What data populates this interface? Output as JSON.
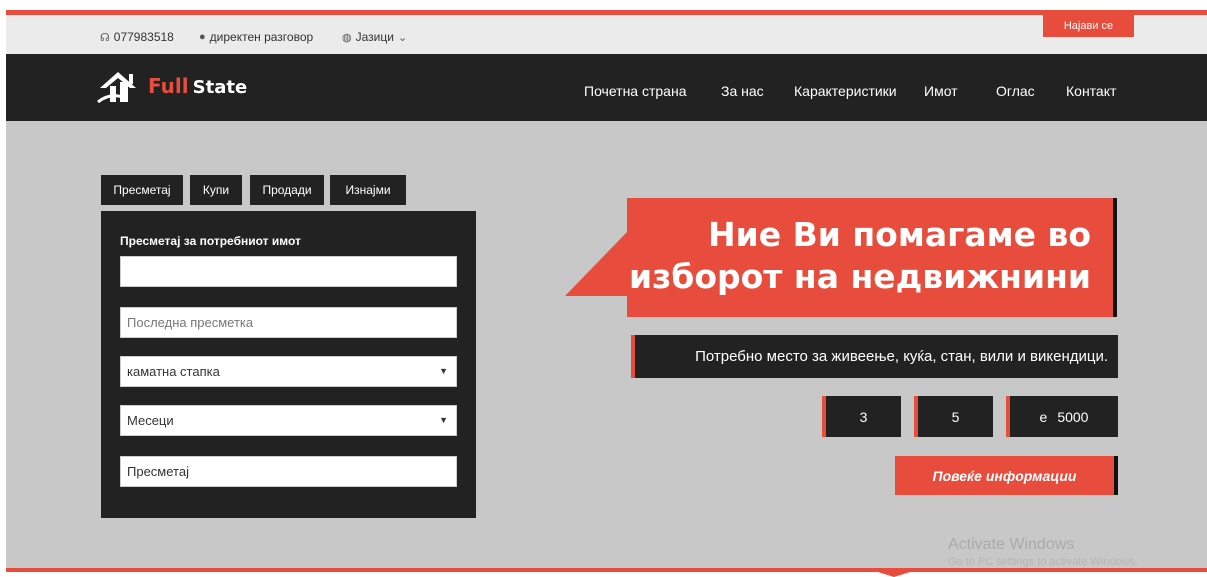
{
  "topbar": {
    "phone": "077983518",
    "chat": "директен разговор",
    "languages": "Јазици",
    "login": "Најави се"
  },
  "brand": {
    "name_part1": "Full",
    "name_part2": "State"
  },
  "nav": {
    "items": [
      "Почетна страна",
      "За нас",
      "Карактеристики",
      "Имот",
      "Оглас",
      "Контакт"
    ]
  },
  "tabs": [
    "Пресметај",
    "Купи",
    "Продади",
    "Изнајми"
  ],
  "calculator": {
    "title": "Пресметај за потребниот имот",
    "input1_value": "",
    "input2_placeholder": "Последна пресметка",
    "select1_value": "каматна стапка",
    "select2_value": "Месеци",
    "submit_label": "Пресметај"
  },
  "hero": {
    "headline_line1": "Ние Ви помагаме во",
    "headline_line2": "изборот на недвижнини",
    "subheadline": "Потребно место за живеење, куќа, стан, вили и викендици.",
    "stats": [
      "3",
      "5"
    ],
    "price_prefix": "e",
    "price_value": "5000",
    "more_button": "Повеќе информации"
  },
  "watermark": {
    "line1": "Activate Windows",
    "line2": "Go to PC settings to activate Windows."
  },
  "colors": {
    "accent": "#e74c3c",
    "dark": "#222222",
    "hero_bg": "#c8c8c8"
  }
}
